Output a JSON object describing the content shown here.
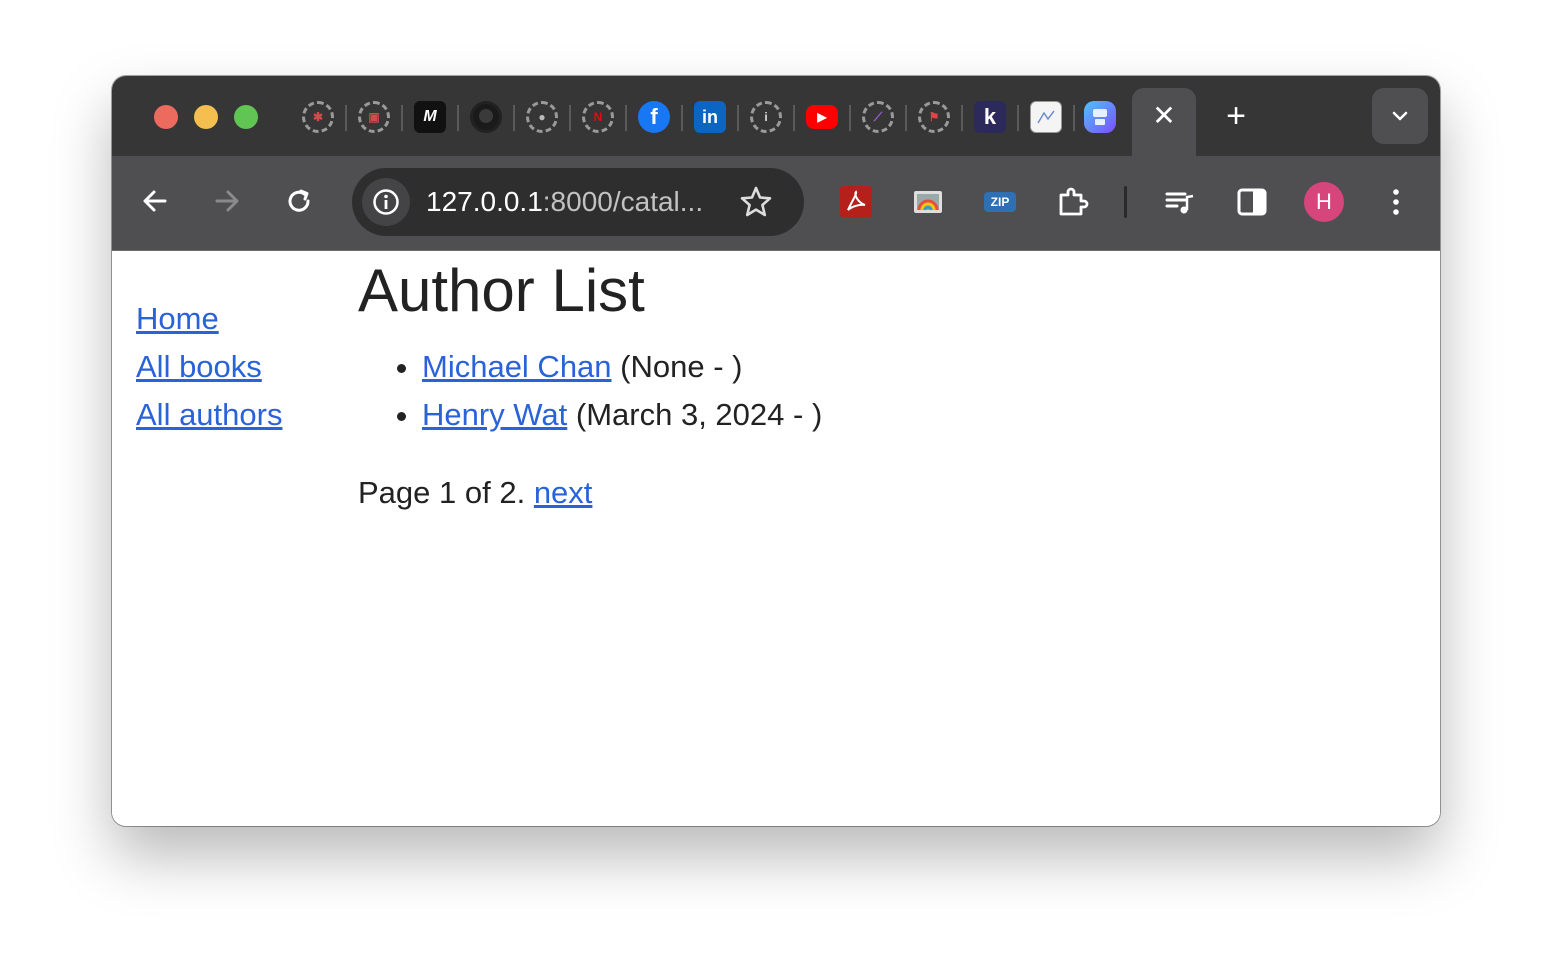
{
  "browser": {
    "tab_favicons": [
      "helm-icon",
      "gitlab-icon",
      "medium-icon",
      "github-icon",
      "github-alt-icon",
      "netflix-icon",
      "facebook-icon",
      "linkedin-icon",
      "info-icon",
      "youtube-icon",
      "devtools-icon",
      "stitcher-icon",
      "k-icon",
      "doc-thumbnail-icon",
      "app-icon"
    ],
    "url": {
      "host": "127.0.0.1",
      "path": ":8000/catal..."
    },
    "profile_initial": "H",
    "zip_label": "ZIP",
    "colors": {
      "tabstrip": "#363636",
      "toolbar": "#4f4f51",
      "link": "#2a62d9",
      "avatar": "#d6457c"
    }
  },
  "sidebar": {
    "links": [
      {
        "label": "Home"
      },
      {
        "label": "All books"
      },
      {
        "label": "All authors"
      }
    ]
  },
  "main": {
    "title": "Author List",
    "authors": [
      {
        "name": "Michael Chan",
        "dates": "(None - )"
      },
      {
        "name": "Henry Wat",
        "dates": "(March 3, 2024 - )"
      }
    ],
    "pagination": {
      "text": "Page 1 of 2.",
      "next_label": "next"
    }
  }
}
